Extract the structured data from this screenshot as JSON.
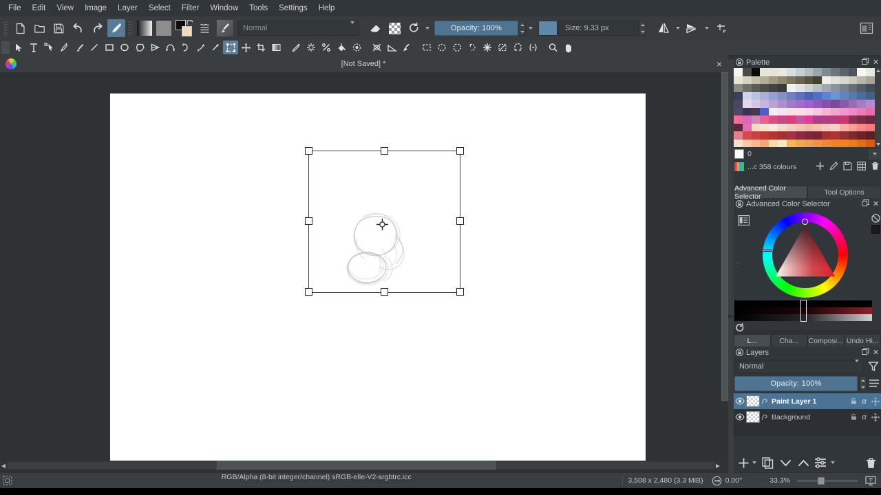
{
  "app": {
    "name": "Krita"
  },
  "menubar": {
    "items": [
      {
        "label": "File"
      },
      {
        "label": "Edit"
      },
      {
        "label": "View"
      },
      {
        "label": "Image"
      },
      {
        "label": "Layer"
      },
      {
        "label": "Select"
      },
      {
        "label": "Filter"
      },
      {
        "label": "Window"
      },
      {
        "label": "Tools"
      },
      {
        "label": "Settings"
      },
      {
        "label": "Help"
      }
    ]
  },
  "toolbar": {
    "new_label": "new-document",
    "open_label": "open-document",
    "save_label": "save-document",
    "undo_label": "undo",
    "redo_label": "redo",
    "brush_preset_label": "brush-preset",
    "gradient_label": "gradient",
    "pattern_label": "pattern",
    "fgbg_label": "foreground-background-color",
    "choose_preset_label": "choose-brush-preset",
    "blending_mode": "Normal",
    "eraser_label": "eraser-mode",
    "alpha_label": "preserve-alpha",
    "reload_label": "reload-preset",
    "opacity_label": "Opacity: 100%",
    "size_label": "Size: 9.33 px",
    "mirror_h_label": "mirror-horizontal",
    "mirror_v_label": "mirror-vertical",
    "wraparound_label": "wrap-around-mode",
    "show_dockers_label": "show-dockers"
  },
  "toolbox": {
    "tools": [
      "select-shapes",
      "text",
      "edit-shapes",
      "calligraphy",
      "freehand-brush",
      "line",
      "rectangle",
      "ellipse",
      "polygon",
      "polyline",
      "bezier-curve",
      "freehand-path",
      "dynamic-brush",
      "multibrush",
      "transform",
      "move",
      "crop",
      "gradient",
      "color-picker",
      "colorize-mask",
      "smart-patch",
      "fill",
      "enclose-and-fill",
      "assistant-editor",
      "measure",
      "reference-images",
      "rectangular-selection",
      "elliptical-selection",
      "polygonal-selection",
      "freehand-selection",
      "contiguous-selection",
      "bezier-selection",
      "magnetic-selection",
      "similar-color-selection",
      "zoom",
      "pan"
    ],
    "active": "transform"
  },
  "document": {
    "title": "[Not Saved] *",
    "close_label": "×"
  },
  "palette_dock": {
    "title": "Palette",
    "selected_index_label": "0",
    "palette_name": "...c 358 colours",
    "buttons": [
      "add-swatch",
      "edit-swatch",
      "save-palette",
      "grid-view",
      "delete-swatch"
    ],
    "rows": [
      [
        "#f5f5f0",
        "#4a4a48",
        "#0b0b0b",
        "#e8e6dc",
        "#e5e3d6",
        "#e9e7de",
        "#d8dde0",
        "#c6ced3",
        "#b2bdc4",
        "#9aa6ae",
        "#7d8a93",
        "#6b767e",
        "#5a636a",
        "#4d555b",
        "#f7f7f2",
        "#e9e9e4"
      ],
      [
        "#e6e4d6",
        "#d5d2bf",
        "#c3bfa9",
        "#b2ad95",
        "#a09a82",
        "#8e8871",
        "#7c765f",
        "#6a644e",
        "#58533f",
        "#47422f",
        "#f0eee6",
        "#e4e2d8",
        "#d9d6cb",
        "#ccc9bd",
        "#b9b6a9",
        "#a7a497"
      ],
      [
        "#8b8b88",
        "#6e6e6b",
        "#5b5b58",
        "#4e4e4c",
        "#424240",
        "#3a3a38",
        "#eef0f2",
        "#dfe3e7",
        "#ccd2d8",
        "#b6bec6",
        "#9fa9b3",
        "#8a95a0",
        "#76828d",
        "#63707b",
        "#525e69",
        "#434e58"
      ],
      [
        "#3a3f55",
        "#cfd3e8",
        "#bcc2e0",
        "#a9b1d8",
        "#96a0d0",
        "#8390c8",
        "#7080c0",
        "#5d70b8",
        "#4a60b0",
        "#4f6fc4",
        "#5d84d0",
        "#6a94d8",
        "#5f86c2",
        "#547aaf",
        "#4a6e9c",
        "#406289"
      ],
      [
        "#4a4560",
        "#e4d8ec",
        "#d6c6e4",
        "#c8b4dc",
        "#baa2d4",
        "#ac90cc",
        "#9e7ec4",
        "#9f6fc8",
        "#a060cc",
        "#9457bb",
        "#8850aa",
        "#7c4999",
        "#8a5aa8",
        "#9a6ab6",
        "#a87ac4",
        "#b68ad2"
      ],
      [
        "#4c4a66",
        "#3a3550",
        "#4a3a46",
        "#4a5fd0",
        "#f2eef6",
        "#f4e6f0",
        "#f6e2ec",
        "#f8dee8",
        "#f9d8e6",
        "#f5c8dc",
        "#f2b8d2",
        "#efa8c8",
        "#f098cc",
        "#f189c6",
        "#ee7ab8",
        "#eb6baa"
      ],
      [
        "#ef6d9e",
        "#d96ab4",
        "#c98ab8",
        "#e86097",
        "#d8507f",
        "#c84a84",
        "#d93f7a",
        "#c8569c",
        "#e03c9c",
        "#a9408c",
        "#b13e84",
        "#bb3c7c",
        "#c43a74",
        "#8e3050",
        "#7a2c46",
        "#6a2840"
      ],
      [
        "#5a2838",
        "#e96cb0",
        "#f3d8c4",
        "#f7e2d0",
        "#f9e8dc",
        "#f6d8cc",
        "#f4cec0",
        "#f2c4b4",
        "#f0baa8",
        "#f4c0b0",
        "#f6c8c0",
        "#f8d0c4",
        "#f9b0a4",
        "#f99c96",
        "#f68888",
        "#f07a7c"
      ],
      [
        "#e0808c",
        "#d84a4a",
        "#cc4040",
        "#c03838",
        "#b43434",
        "#a83030",
        "#a82f4a",
        "#8e2a3e",
        "#802638",
        "#7a2434",
        "#a63030",
        "#b03434",
        "#9a2e2e",
        "#7e2828",
        "#6a2424",
        "#5c2020"
      ],
      [
        "#f4e0cc",
        "#f6c8a8",
        "#f4b894",
        "#f0a87c",
        "#f6dca8",
        "#f8e8c0",
        "#f0b858",
        "#eeaa44",
        "#f09c50",
        "#ee9440",
        "#f08a30",
        "#ef8420",
        "#f08418",
        "#ee7c14",
        "#e86c10",
        "#d85c0c"
      ]
    ]
  },
  "color_selector_dock": {
    "tabs": [
      {
        "label": "Advanced Color Selector",
        "selected": true
      },
      {
        "label": "Tool Options",
        "selected": false
      }
    ],
    "title": "Advanced Color Selector",
    "settings_label": "selector-settings",
    "clear_label": "clear-color-history",
    "reset_label": "reset-color",
    "fg_color": "#1a1a1a"
  },
  "layers_dock": {
    "tabs": [
      {
        "label": "L...",
        "selected": true
      },
      {
        "label": "Cha...",
        "selected": false
      },
      {
        "label": "Composi...",
        "selected": false
      },
      {
        "label": "Undo Hi...",
        "selected": false
      }
    ],
    "title": "Layers",
    "blending_mode": "Normal",
    "opacity_label": "Opacity:  100%",
    "filter_label": "filter-layers",
    "menu_label": "layer-properties-menu",
    "layers": [
      {
        "name": "Paint Layer 1",
        "selected": true,
        "visible": true,
        "locked": false
      },
      {
        "name": "Background",
        "selected": false,
        "visible": true,
        "locked": false
      }
    ],
    "footer_buttons": [
      "add-layer",
      "duplicate-layer",
      "move-layer-down",
      "move-layer-up",
      "layer-properties",
      "delete-layer"
    ]
  },
  "statusbar": {
    "selection_label": "selection-mode",
    "color_profile": "RGB/Alpha (8-bit integer/channel)  sRGB-elle-V2-srgbtrc.icc",
    "image_size": "3,508 x 2,480 (3.3 MiB)",
    "rotation": "0.00°",
    "zoom": "33.3%",
    "fit_label": "fit-to-canvas"
  },
  "colors": {
    "accent_blue": "#4f7492",
    "layer_select_blue": "#4a7396",
    "toolbar_bg": "#383c3f",
    "dock_bg": "#31363b",
    "menubar_bg": "#31363b"
  }
}
